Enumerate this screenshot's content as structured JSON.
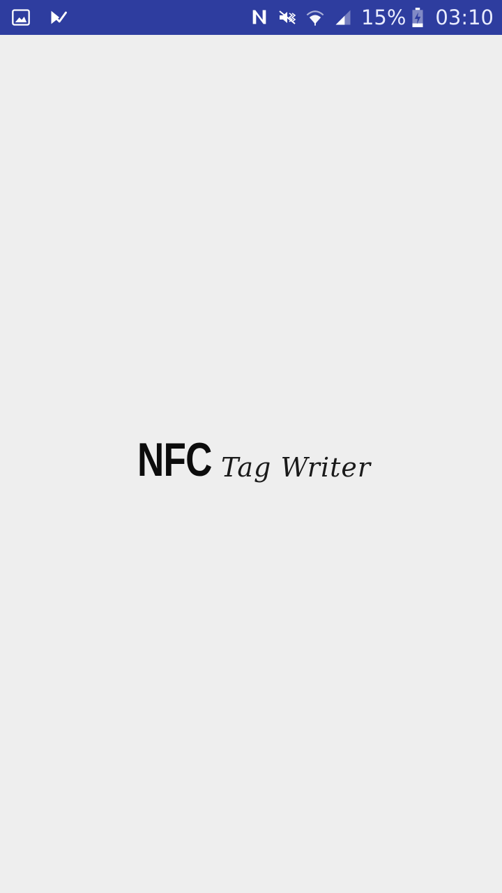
{
  "status_bar": {
    "background_color": "#2e3d9f",
    "left_icons": [
      "gallery-icon",
      "task-check-icon"
    ],
    "right_icons": [
      "nfc-icon",
      "vibrate-mute-icon",
      "wifi-icon",
      "signal-icon",
      "battery-charging-icon"
    ],
    "battery_percent": "15%",
    "time": "03:10"
  },
  "splash": {
    "logo_primary": "NFC",
    "logo_secondary": "Tag Writer"
  },
  "colors": {
    "background": "#eeeeee",
    "logo_text": "#0c0c0c"
  }
}
